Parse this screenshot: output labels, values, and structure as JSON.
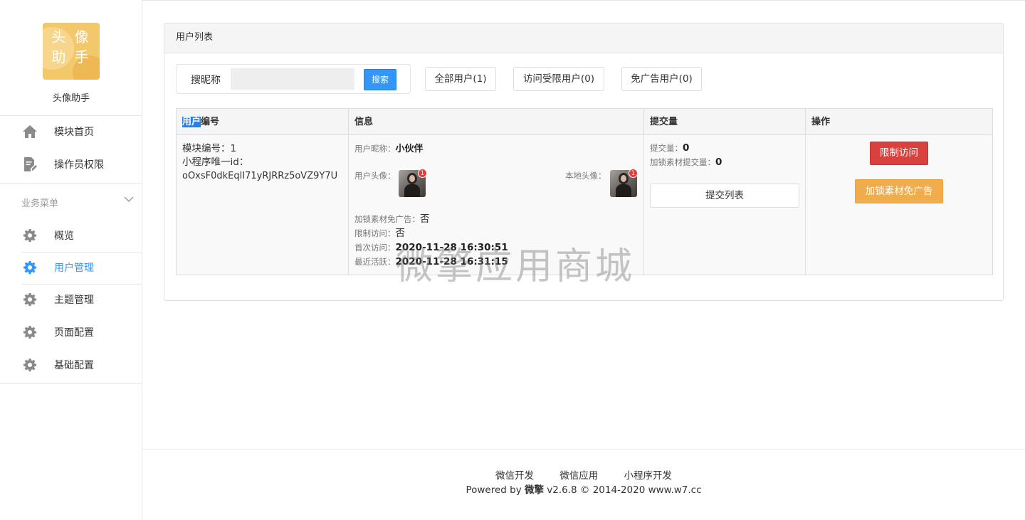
{
  "sidebar": {
    "logo_text_line1": "头 像",
    "logo_text_line2": "助 手",
    "app_name": "头像助手",
    "top_items": [
      {
        "label": "模块首页",
        "icon": "home-icon"
      },
      {
        "label": "操作员权限",
        "icon": "document-edit-icon"
      }
    ],
    "section_title": "业务菜单",
    "section_items": [
      {
        "label": "概览",
        "icon": "gear-icon",
        "active": false
      },
      {
        "label": "用户管理",
        "icon": "gear-icon",
        "active": true
      },
      {
        "label": "主题管理",
        "icon": "gear-icon",
        "active": false
      },
      {
        "label": "页面配置",
        "icon": "gear-icon",
        "active": false
      },
      {
        "label": "基础配置",
        "icon": "gear-icon",
        "active": false
      }
    ],
    "accent_color": "#3296fa"
  },
  "panel": {
    "title": "用户列表",
    "search": {
      "label": "搜昵称",
      "value": "",
      "button": "搜索"
    },
    "filters": [
      {
        "label": "全部用户(1)"
      },
      {
        "label": "访问受限用户(0)"
      },
      {
        "label": "免广告用户(0)"
      }
    ],
    "table": {
      "headers": {
        "col1_highlight": "用户",
        "col1_rest": "编号",
        "col2": "信息",
        "col3": "提交量",
        "col4": "操作"
      },
      "row": {
        "module_no": "模块编号：1",
        "openid_label": "小程序唯一id：",
        "openid": "oOxsF0dkEqlI71yRJRRz5oVZ9Y7U",
        "nickname_label": "用户昵称：",
        "nickname": "小伙伴",
        "avatar_label": "用户头像：",
        "avatar_badge": "1",
        "local_avatar_label": "本地头像：",
        "local_avatar_badge": "1",
        "lock_free_ad_label": "加锁素材免广告：",
        "lock_free_ad_value": "否",
        "restricted_label": "限制访问：",
        "restricted_value": "否",
        "first_visit_label": "首次访问：",
        "first_visit_value": "2020-11-28 16:30:51",
        "last_active_label": "最近活跃：",
        "last_active_value": "2020-11-28 16:31:15",
        "submit_label": "提交量：",
        "submit_value": "0",
        "lock_submit_label": "加锁素材提交量：",
        "lock_submit_value": "0",
        "submit_list_button": "提交列表",
        "restrict_button": "限制访问",
        "free_ad_button": "加锁素材免广告"
      }
    }
  },
  "watermark": "微擎应用商城",
  "footer": {
    "links": [
      "微信开发",
      "微信应用",
      "小程序开发"
    ],
    "copy_prefix": "Powered by ",
    "copy_brand": "微擎",
    "copy_suffix": " v2.6.8 © 2014-2020 www.w7.cc"
  }
}
